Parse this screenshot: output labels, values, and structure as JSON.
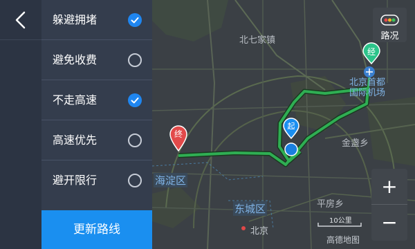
{
  "sidebar": {
    "back_icon": "chevron-left-icon"
  },
  "route_options": [
    {
      "label": "躲避拥堵",
      "checked": true
    },
    {
      "label": "避免收费",
      "checked": false
    },
    {
      "label": "不走高速",
      "checked": true
    },
    {
      "label": "高速优先",
      "checked": false
    },
    {
      "label": "避开限行",
      "checked": false
    }
  ],
  "update_button": {
    "label": "更新路线"
  },
  "map": {
    "labels": {
      "beiqijia": "北七家镇",
      "airport": "北京首都\n国际机场",
      "jinzhan": "金盏乡",
      "haidian": "海淀区",
      "dongcheng": "东城区",
      "beijing": "北京",
      "pingfang": "平房乡"
    },
    "start_marker": "起",
    "end_marker": "终",
    "via_marker": "经",
    "scale": "10公里",
    "watermark": "高德地图",
    "colors": {
      "route": "#2fae53",
      "accent": "#1a8ff0",
      "start": "#1a8ff0",
      "end": "#e24a4a",
      "via": "#2cc48a"
    }
  },
  "controls": {
    "traffic_label": "路况",
    "zoom_in": "+",
    "zoom_out": "−"
  }
}
